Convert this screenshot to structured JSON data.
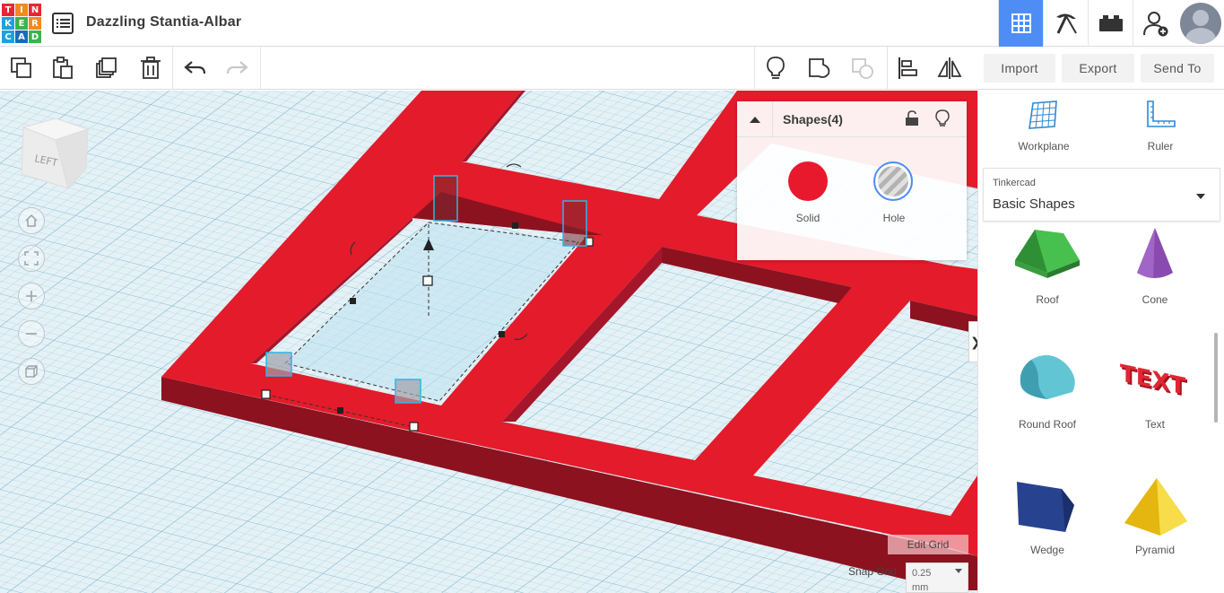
{
  "app": {
    "logo_letters": [
      "T",
      "I",
      "N",
      "K",
      "E",
      "R",
      "C",
      "A",
      "D"
    ],
    "logo_colors": [
      "#e8262f",
      "#f38a1d",
      "#e8262f",
      "#1fa1dc",
      "#3bb44a",
      "#f38a1d",
      "#1fa1dc",
      "#1b6bb7",
      "#3bb44a"
    ],
    "document_title": "Dazzling Stantia-Albar"
  },
  "topbar": {
    "buttons": [
      {
        "name": "3d-design-view",
        "icon": "grid-icon",
        "active": true
      },
      {
        "name": "codeblocks",
        "icon": "pickaxe-icon",
        "active": false
      },
      {
        "name": "bricks",
        "icon": "brick-icon",
        "active": false
      },
      {
        "name": "invite",
        "icon": "add-user-icon",
        "active": false
      }
    ]
  },
  "toolbar": {
    "import_label": "Import",
    "export_label": "Export",
    "send_to_label": "Send To"
  },
  "viewcube": {
    "face_label": "LEFT"
  },
  "inspector": {
    "title": "Shapes(4)",
    "solid_label": "Solid",
    "hole_label": "Hole",
    "solid_color": "#e8192c"
  },
  "workplane": {
    "edit_grid_label": "Edit Grid",
    "snap_grid_label": "Snap Grid",
    "snap_grid_value": "0.25",
    "snap_grid_unit": "mm"
  },
  "panel": {
    "workplane_label": "Workplane",
    "ruler_label": "Ruler",
    "library_category": "Tinkercad",
    "library_name": "Basic Shapes",
    "shapes": [
      {
        "label": "Roof",
        "color": "#3cb044"
      },
      {
        "label": "Cone",
        "color": "#7b3f9e"
      },
      {
        "label": "Round Roof",
        "color": "#4cb4c4"
      },
      {
        "label": "Text",
        "color": "#d8232f"
      },
      {
        "label": "Wedge",
        "color": "#1e3a8a"
      },
      {
        "label": "Pyramid",
        "color": "#f2c318"
      }
    ]
  }
}
